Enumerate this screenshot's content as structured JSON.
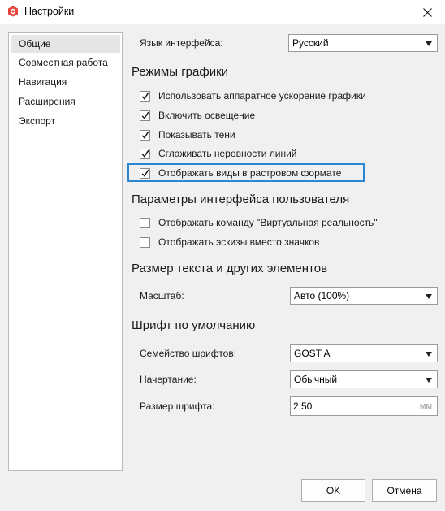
{
  "window": {
    "title": "Настройки",
    "icon": "app-logo-icon",
    "close_icon": "close-icon"
  },
  "sidebar": {
    "items": [
      {
        "label": "Общие",
        "active": true
      },
      {
        "label": "Совместная работа",
        "active": false
      },
      {
        "label": "Навигация",
        "active": false
      },
      {
        "label": "Расширения",
        "active": false
      },
      {
        "label": "Экспорт",
        "active": false
      }
    ]
  },
  "language": {
    "label": "Язык интерфейса:",
    "value": "Русский"
  },
  "graphics": {
    "heading": "Режимы графики",
    "options": [
      {
        "label": "Использовать аппаратное ускорение графики",
        "checked": true
      },
      {
        "label": "Включить освещение",
        "checked": true
      },
      {
        "label": "Показывать тени",
        "checked": true
      },
      {
        "label": "Сглаживать неровности линий",
        "checked": true
      },
      {
        "label": "Отображать виды в растровом формате",
        "checked": true
      }
    ]
  },
  "ui_params": {
    "heading": "Параметры интерфейса пользователя",
    "options": [
      {
        "label": "Отображать команду \"Виртуальная реальность\"",
        "checked": false
      },
      {
        "label": "Отображать эскизы вместо значков",
        "checked": false
      }
    ]
  },
  "text_size": {
    "heading": "Размер текста и других элементов",
    "scale_label": "Масштаб:",
    "scale_value": "Авто (100%)"
  },
  "font": {
    "heading": "Шрифт по умолчанию",
    "family_label": "Семейство шрифтов:",
    "family_value": "GOST A",
    "style_label": "Начертание:",
    "style_value": "Обычный",
    "size_label": "Размер шрифта:",
    "size_value": "2,50",
    "size_unit": "мм"
  },
  "buttons": {
    "ok": "OK",
    "cancel": "Отмена"
  },
  "colors": {
    "focus_border": "#2b86d3",
    "app_icon": "#e8453c"
  }
}
